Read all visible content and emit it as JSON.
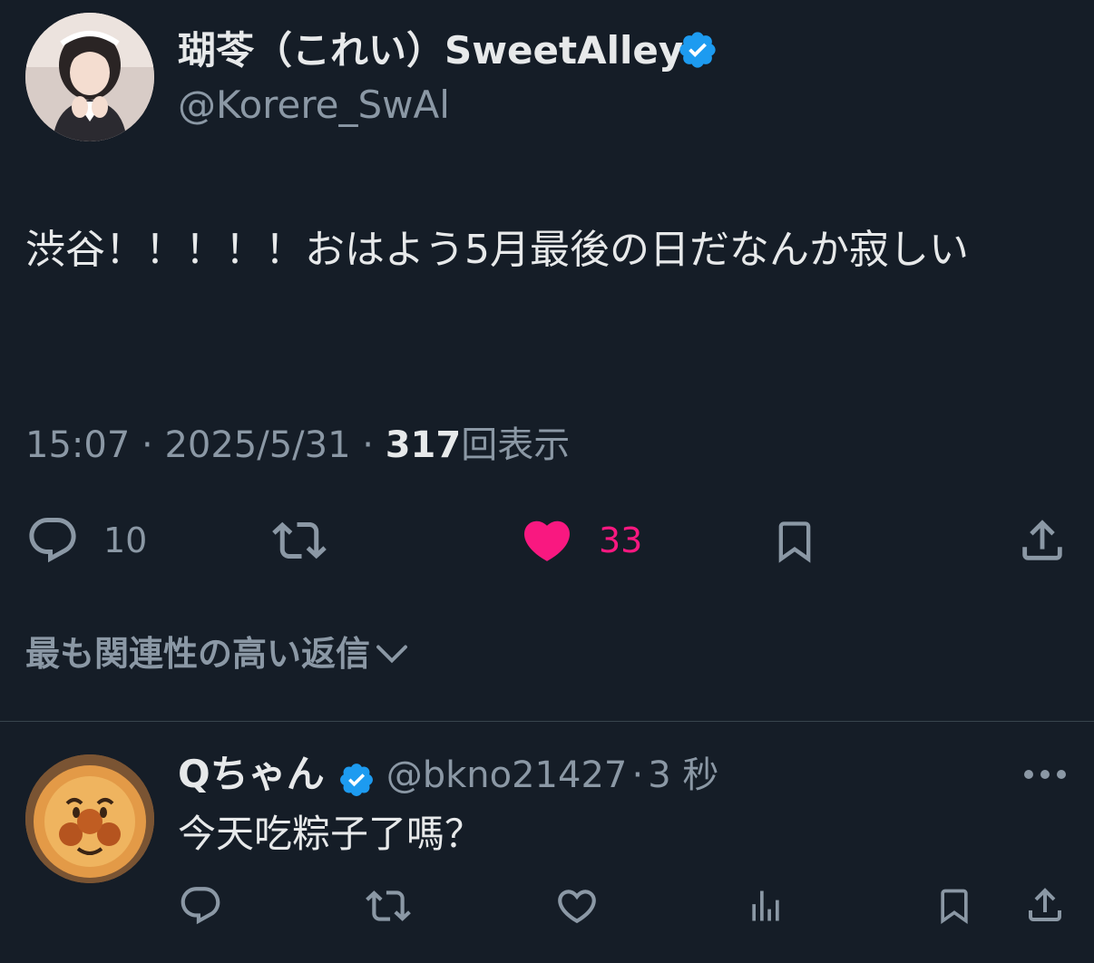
{
  "tweet": {
    "author_name": "瑚苓（これい）SweetAlley",
    "author_handle": "@Korere_SwAl",
    "text": "渋谷！！！！！おはよう5月最後の日だなんか寂しい",
    "time": "15:07",
    "date": "2025/5/31",
    "separator": "·",
    "views_count": "317",
    "views_label": "回表示",
    "reply_count": "10",
    "like_count": "33",
    "liked": true
  },
  "replies_section": {
    "sort_label": "最も関連性の高い返信"
  },
  "reply": {
    "author_name": "Qちゃん",
    "author_handle": "@bkno21427",
    "separator": "·",
    "time_ago": "3 秒",
    "text": "今天吃粽子了嗎？"
  },
  "icons": {
    "verified": "verified-badge-icon",
    "reply": "reply-icon",
    "retweet": "retweet-icon",
    "like": "heart-icon",
    "bookmark": "bookmark-icon",
    "share": "share-icon",
    "analytics": "analytics-icon",
    "more": "more-icon",
    "chevron": "chevron-down-icon"
  },
  "colors": {
    "background": "#151d27",
    "primary_text": "#e7e9ea",
    "secondary_text": "#8b98a5",
    "verified_blue": "#1d9bf0",
    "like_pink": "#f91880",
    "divider": "#38444d"
  }
}
